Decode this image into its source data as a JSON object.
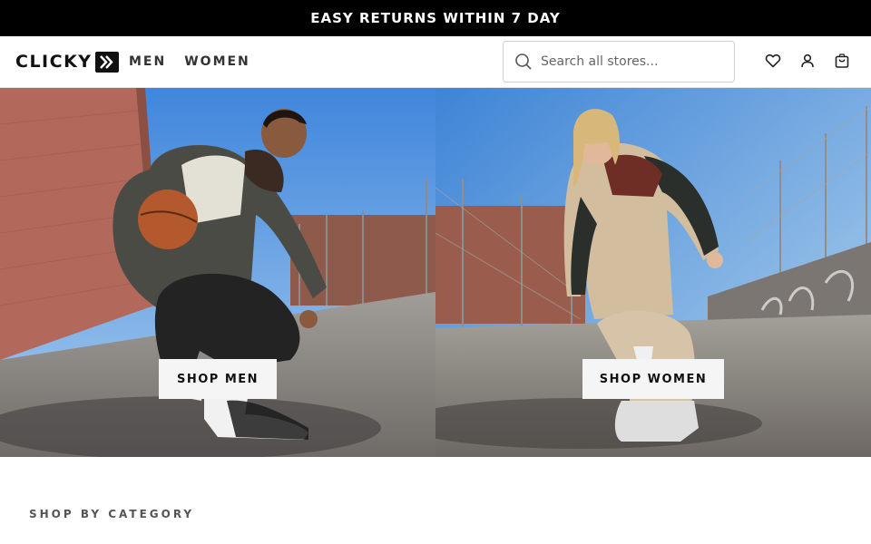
{
  "announcement": "EASY RETURNS WITHIN 7 DAY",
  "brand": {
    "name": "CLICKY"
  },
  "nav": {
    "men": "MEN",
    "women": "WOMEN"
  },
  "search": {
    "placeholder": "Search all stores..."
  },
  "header_icons": [
    "heart-icon",
    "user-icon",
    "bag-icon"
  ],
  "hero": {
    "men_button": "SHOP MEN",
    "women_button": "SHOP WOMEN"
  },
  "section": {
    "title": "SHOP BY CATEGORY"
  },
  "colors": {
    "bar": "#000000",
    "sky": "#4f8fd9",
    "brick": "#b4675a",
    "ground": "#8f8a86"
  }
}
